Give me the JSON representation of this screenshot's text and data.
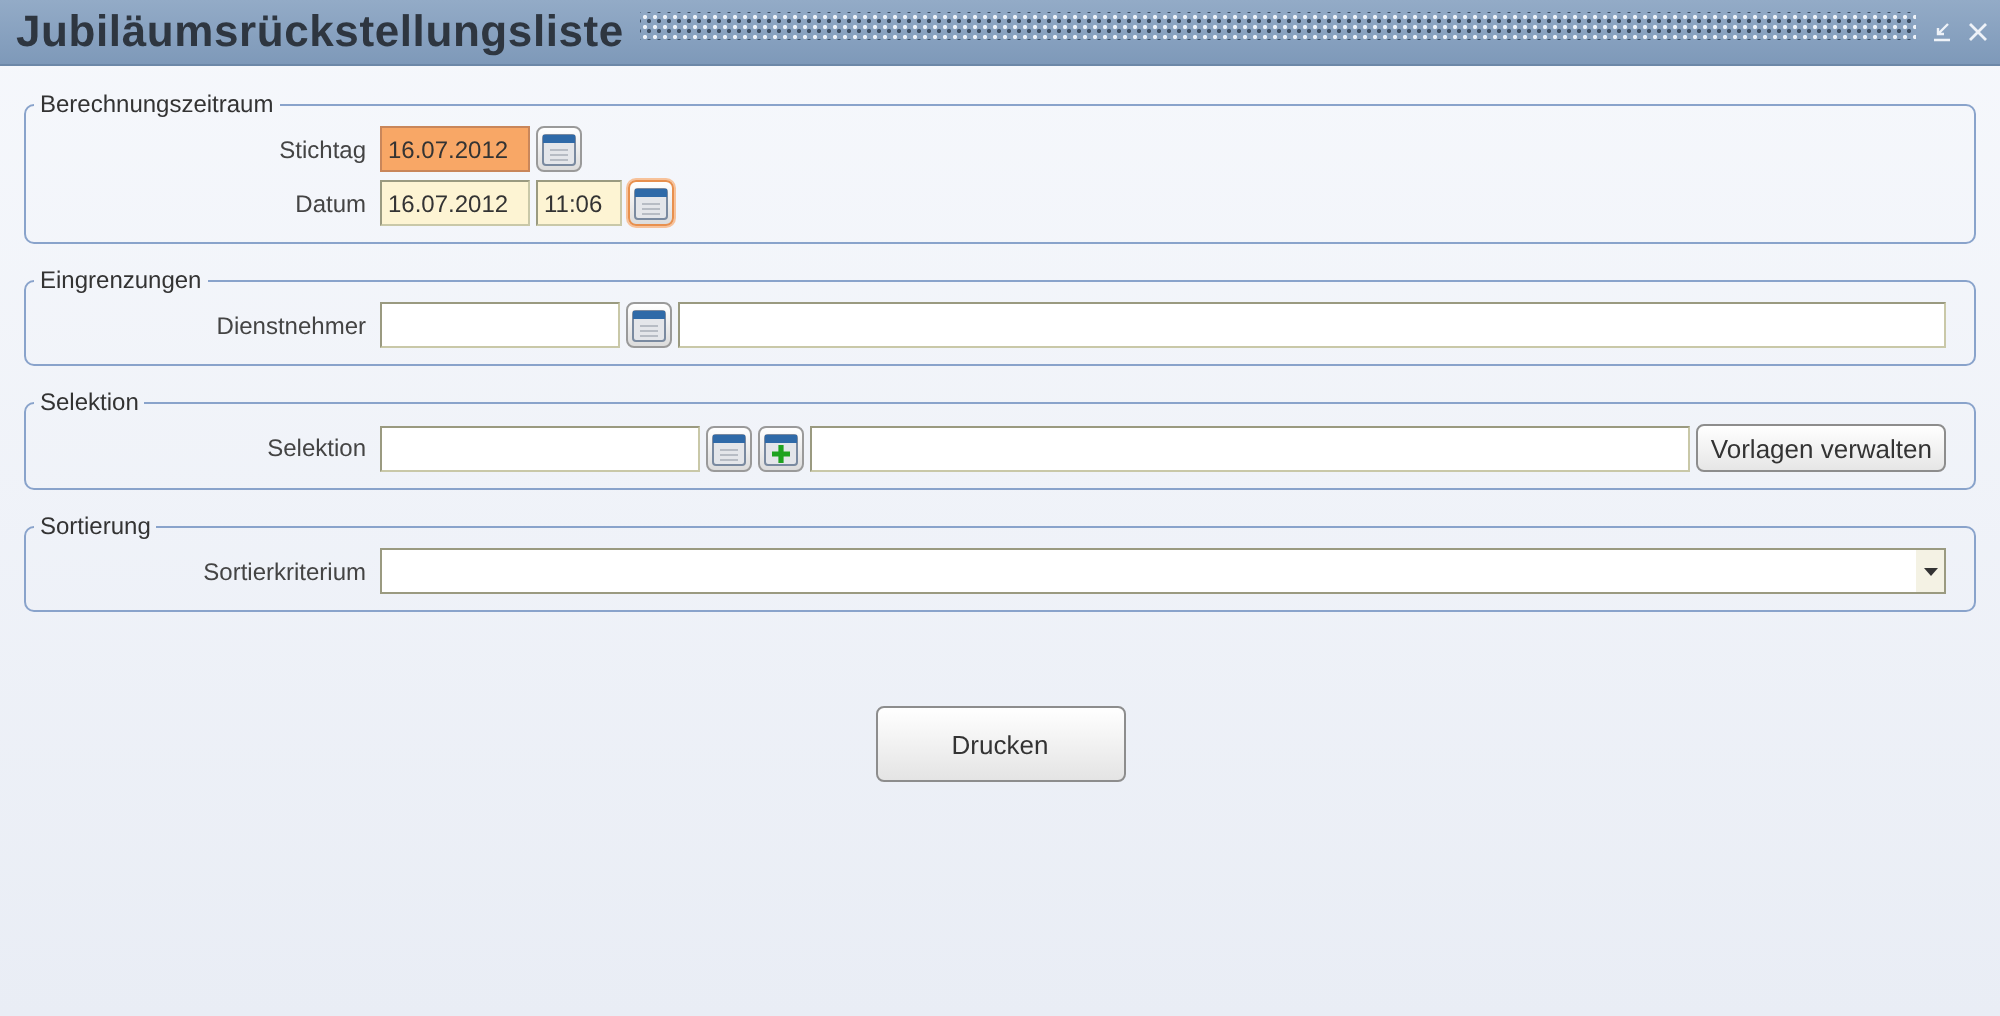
{
  "window": {
    "title": "Jubiläumsrückstellungsliste"
  },
  "groups": [
    {
      "legend": "Berechnungszeitraum",
      "rows": [
        {
          "label": "Stichtag",
          "controls": [
            {
              "kind": "date-field",
              "value": "16.07.2012",
              "focused": true
            },
            {
              "kind": "picker-button",
              "highlighted": false
            }
          ]
        },
        {
          "label": "Datum",
          "controls": [
            {
              "kind": "date-field",
              "value": "16.07.2012",
              "focused": false
            },
            {
              "kind": "time-field",
              "value": "11:06",
              "focused": false
            },
            {
              "kind": "picker-button",
              "highlighted": true
            }
          ]
        }
      ]
    },
    {
      "legend": "Eingrenzungen",
      "rows": [
        {
          "label": "Dienstnehmer",
          "controls": [
            {
              "kind": "number-field",
              "focused": false
            },
            {
              "kind": "picker-button",
              "highlighted": false
            },
            {
              "kind": "text-field",
              "focused": false
            }
          ]
        }
      ]
    },
    {
      "legend": "Selektion",
      "rows": [
        {
          "label": "Selektion",
          "controls": [
            {
              "kind": "selection-field",
              "focused": false
            },
            {
              "kind": "picker-button",
              "highlighted": false
            },
            {
              "kind": "add-button",
              "highlighted": false
            },
            {
              "kind": "text-field",
              "focused": false
            },
            {
              "kind": "action-button",
              "label": "Vorlagen verwalten"
            }
          ]
        }
      ]
    },
    {
      "legend": "Sortierung",
      "rows": [
        {
          "label": "Sortierkriterium",
          "controls": [
            {
              "kind": "dropdown",
              "focused": false
            }
          ]
        }
      ]
    }
  ],
  "print_button": {
    "label": "Drucken"
  }
}
